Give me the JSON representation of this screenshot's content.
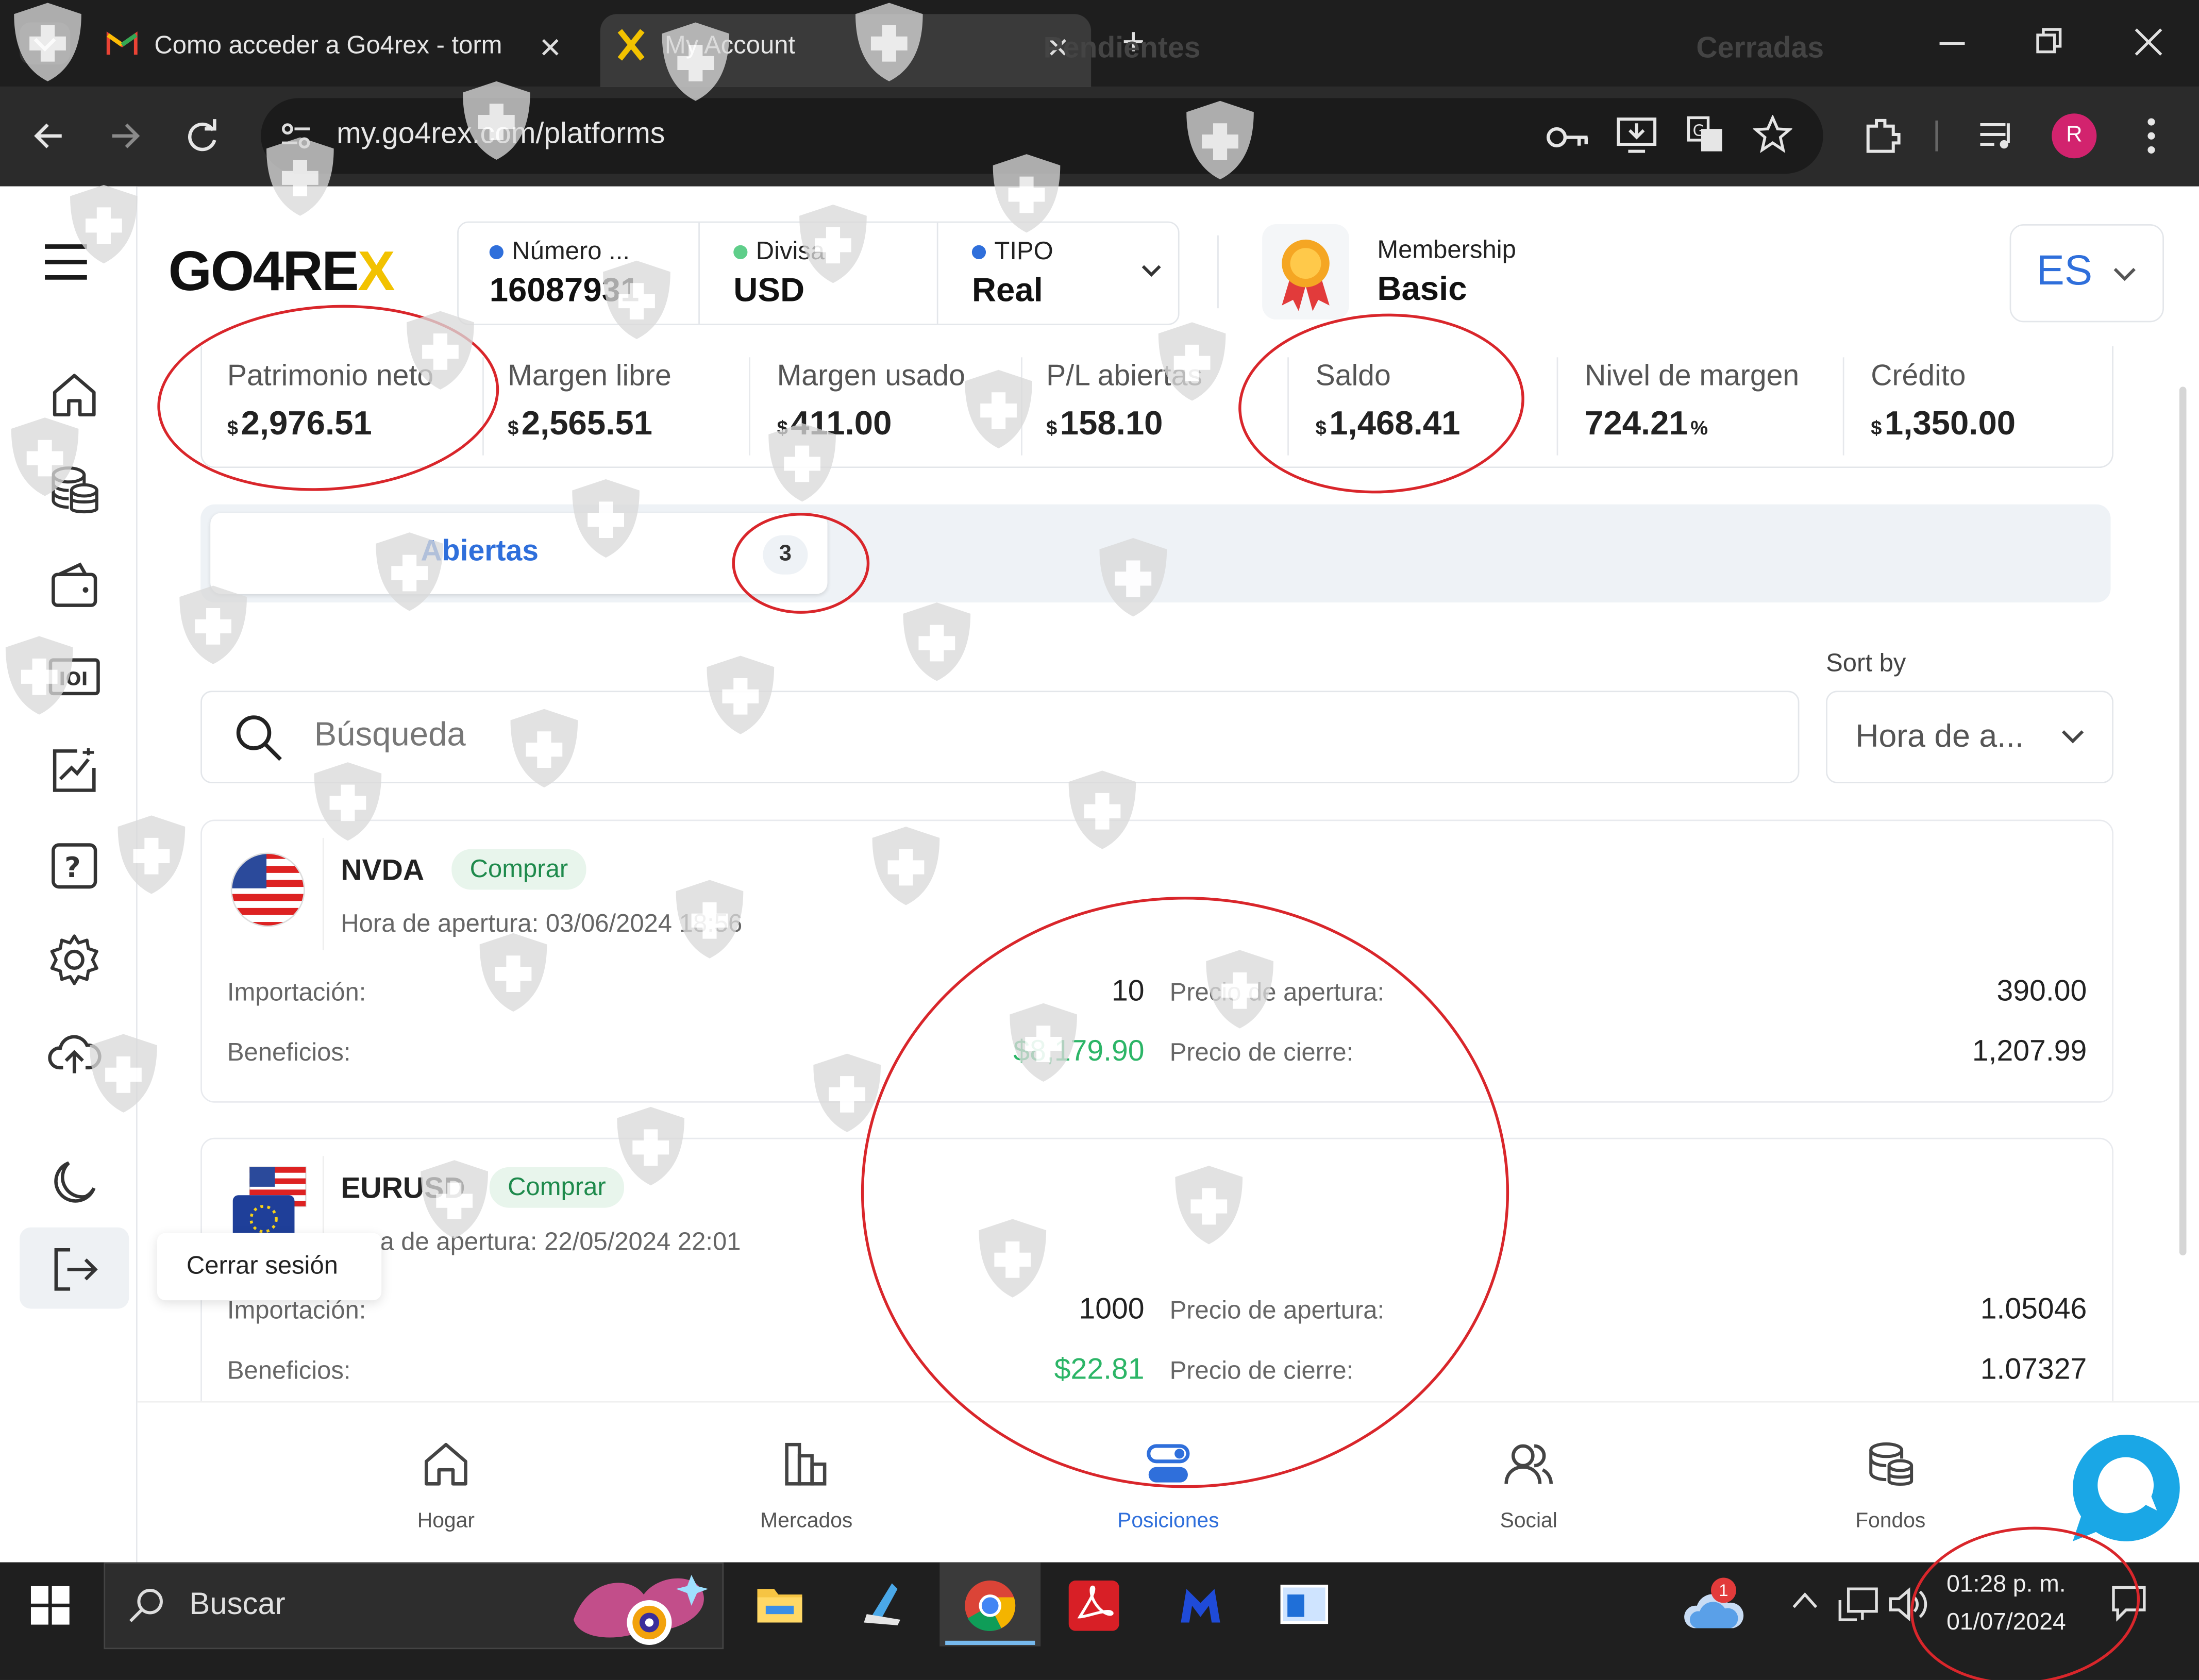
{
  "browser": {
    "tabs": [
      {
        "title": "Como acceder a Go4rex - torm",
        "icon": "gmail-icon",
        "active": false
      },
      {
        "title": "My Account",
        "icon": "go4rex-x-icon",
        "active": true
      }
    ],
    "new_tab_symbol": "+",
    "url": "my.go4rex.com/platforms",
    "profile_initial": "R",
    "accent": "#d2236e"
  },
  "app": {
    "brand": {
      "text_main": "GO4RE",
      "text_accent": "X",
      "accent_color": "#f2c200"
    },
    "account": {
      "number_label": "Número ...",
      "number_value": "16087931",
      "currency_label": "Divisa",
      "currency_value": "USD",
      "type_label": "TIPO",
      "type_value": "Real"
    },
    "membership": {
      "label": "Membership",
      "value": "Basic"
    },
    "language": "ES",
    "stats": [
      {
        "label": "Patrimonio neto",
        "currency": "$",
        "value": "2,976.51"
      },
      {
        "label": "Margen libre",
        "currency": "$",
        "value": "2,565.51"
      },
      {
        "label": "Margen usado",
        "currency": "$",
        "value": "411.00"
      },
      {
        "label": "P/L abiertas",
        "currency": "$",
        "value": "158.10"
      },
      {
        "label": "Saldo",
        "currency": "$",
        "value": "1,468.41"
      },
      {
        "label": "Nivel de margen",
        "value": "724.21",
        "suffix": "%"
      },
      {
        "label": "Crédito",
        "currency": "$",
        "value": "1,350.00"
      }
    ],
    "position_tabs": [
      {
        "label": "Abiertas",
        "count": "3",
        "active": true
      },
      {
        "label": "Pendientes",
        "active": false
      },
      {
        "label": "Cerradas",
        "active": false
      }
    ],
    "sort_label": "Sort by",
    "sort_value": "Hora de a...",
    "search_placeholder": "Búsqueda",
    "positions": [
      {
        "symbol": "NVDA",
        "side": "Comprar",
        "open_time_label": "Hora de apertura:",
        "open_time": "03/06/2024 18:56",
        "amount_label": "Importación:",
        "amount": "10",
        "profit_label": "Beneficios:",
        "profit": "$8,179.90",
        "open_price_label": "Precio de apertura:",
        "open_price": "390.00",
        "close_price_label": "Precio de cierre:",
        "close_price": "1,207.99"
      },
      {
        "symbol": "EURUSD",
        "side": "Comprar",
        "open_time_label": "ra de apertura:",
        "open_time": "22/05/2024 22:01",
        "amount_label": "Importación:",
        "amount": "1000",
        "profit_label": "Beneficios:",
        "profit": "$22.81",
        "open_price_label": "Precio de apertura:",
        "open_price": "1.05046",
        "close_price_label": "Precio de cierre:",
        "close_price": "1.07327"
      }
    ],
    "logout_tooltip": "Cerrar sesión",
    "bottom_nav": [
      {
        "label": "Hogar",
        "icon": "home-icon",
        "active": false
      },
      {
        "label": "Mercados",
        "icon": "markets-icon",
        "active": false
      },
      {
        "label": "Posiciones",
        "icon": "positions-icon",
        "active": true
      },
      {
        "label": "Social",
        "icon": "social-icon",
        "active": false
      },
      {
        "label": "Fondos",
        "icon": "funds-icon",
        "active": false
      }
    ],
    "colors": {
      "primary": "#2f6fdb",
      "profit": "#2cb567",
      "chat": "#1aa7e6"
    }
  },
  "taskbar": {
    "search_placeholder": "Buscar",
    "time": "01:28 p. m.",
    "date": "01/07/2024",
    "weather_badge": "1"
  }
}
